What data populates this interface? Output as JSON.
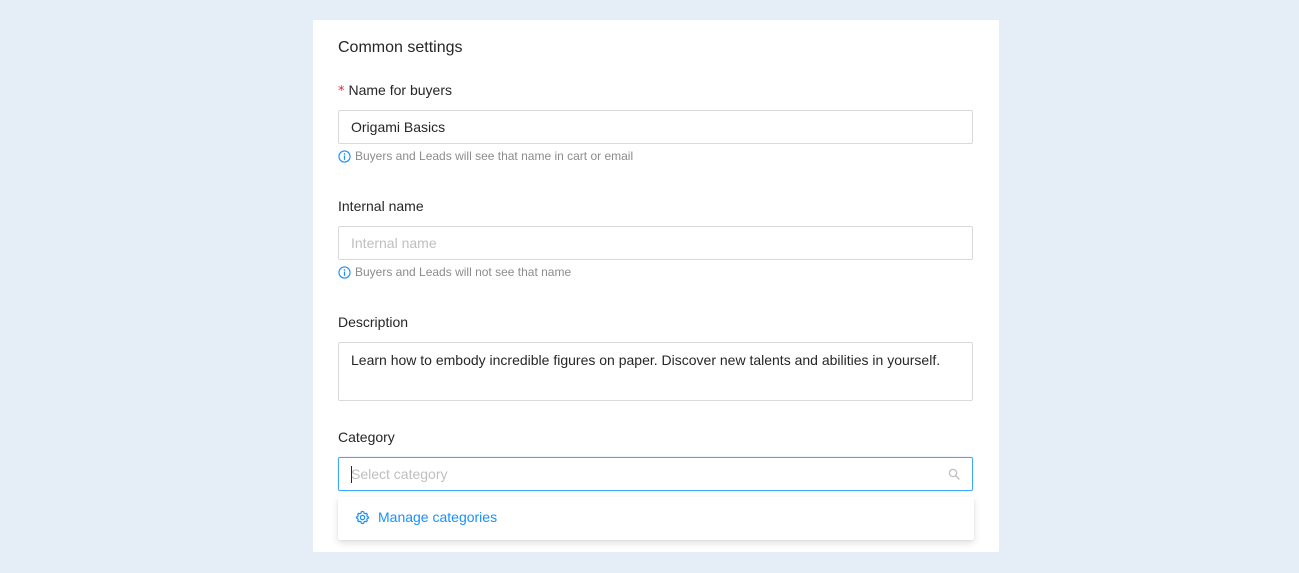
{
  "section": {
    "title": "Common settings"
  },
  "fields": {
    "name_for_buyers": {
      "label": "Name for buyers",
      "required_mark": "*",
      "value": "Origami Basics",
      "hint": "Buyers and Leads will see that name in cart or email"
    },
    "internal_name": {
      "label": "Internal name",
      "value": "",
      "placeholder": "Internal name",
      "hint": "Buyers and Leads will not see that name"
    },
    "description": {
      "label": "Description",
      "value": "Learn how to embody incredible figures on paper. Discover new talents and abilities in yourself."
    },
    "category": {
      "label": "Category",
      "value": "",
      "placeholder": "Select category"
    }
  },
  "dropdown": {
    "items": [
      {
        "label": "Manage categories",
        "icon": "gear-icon"
      }
    ]
  },
  "colors": {
    "background": "#e5edf6",
    "panel": "#ffffff",
    "accent": "#1890ff",
    "required": "#f5222d",
    "hint_text": "#8c8c8c"
  }
}
